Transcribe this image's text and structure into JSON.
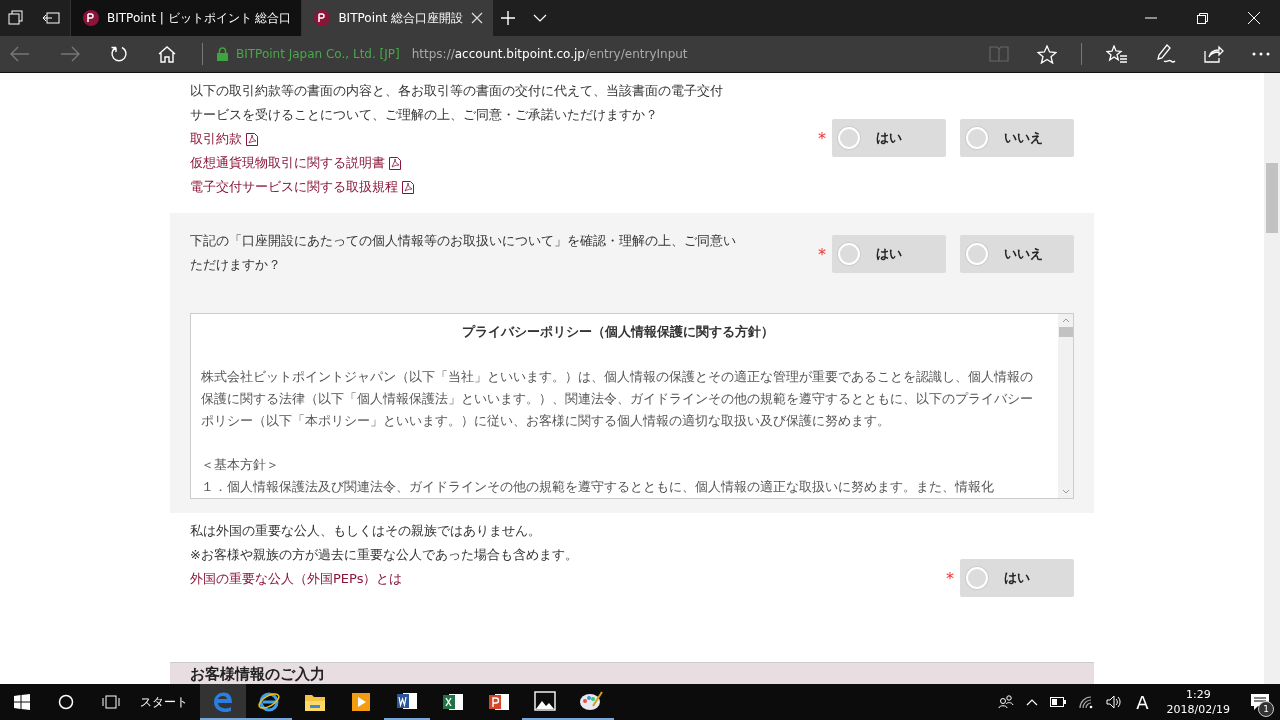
{
  "browser": {
    "tabs": [
      {
        "title": "BITPoint | ビットポイント 総合口",
        "selected": false
      },
      {
        "title": "BITPoint 総合口座開設",
        "selected": true
      }
    ],
    "address": {
      "identity": "BITPoint Japan Co., Ltd. [JP]",
      "scheme": "https://",
      "host": "account.bitpoint.co.jp",
      "path": "/entry/entryInput"
    }
  },
  "questions": [
    {
      "shaded": false,
      "text": [
        "以下の取引約款等の書面の内容と、各お取引等の書面の交付に代えて、当該書面の電子交付",
        "サービスを受けることについて、ご理解の上、ご同意・ご承諾いただけますか？"
      ],
      "links": [
        "取引約款",
        "仮想通貨現物取引に関する説明書",
        "電子交付サービスに関する取扱規程"
      ],
      "required_mark": "*",
      "options": [
        {
          "label": "はい",
          "selected": false
        },
        {
          "label": "いいえ",
          "selected": false
        }
      ]
    },
    {
      "shaded": true,
      "text": [
        "下記の「口座開設にあたっての個人情報等のお取扱いについて」を確認・理解の上、ご同意い",
        "ただけますか？"
      ],
      "required_mark": "*",
      "options": [
        {
          "label": "はい",
          "selected": false
        },
        {
          "label": "いいえ",
          "selected": false
        }
      ],
      "policy": {
        "title": "プライバシーポリシー（個人情報保護に関する方針）",
        "paragraphs": [
          "株式会社ビットポイントジャパン（以下「当社」といいます。）は、個人情報の保護とその適正な管理が重要であることを認識し、個人情報の保護に関する法律（以下「個人情報保護法」といいます。）、関連法令、ガイドラインその他の規範を遵守するとともに、以下のプライバシーポリシー（以下「本ポリシー」といいます。）に従い、お客様に関する個人情報の適切な取扱い及び保護に努めます。",
          "＜基本方針＞",
          "１．個人情報保護法及び関連法令、ガイドラインその他の規範を遵守するとともに、個人情報の適正な取扱いに努めます。また、情報化"
        ]
      }
    },
    {
      "shaded": false,
      "text": [
        "私は外国の重要な公人、もしくはその親族ではありません。",
        "※お客様や親族の方が過去に重要な公人であった場合も含めます。"
      ],
      "links": [
        "外国の重要な公人（外国PEPs）とは"
      ],
      "required_mark": "*",
      "options": [
        {
          "label": "はい",
          "selected": false
        }
      ]
    }
  ],
  "next_section": "お客様情報のご入力",
  "taskbar": {
    "start_label": "スタート",
    "time": "1:29",
    "date": "2018/02/19",
    "ime": "A",
    "notifications": "1"
  }
}
